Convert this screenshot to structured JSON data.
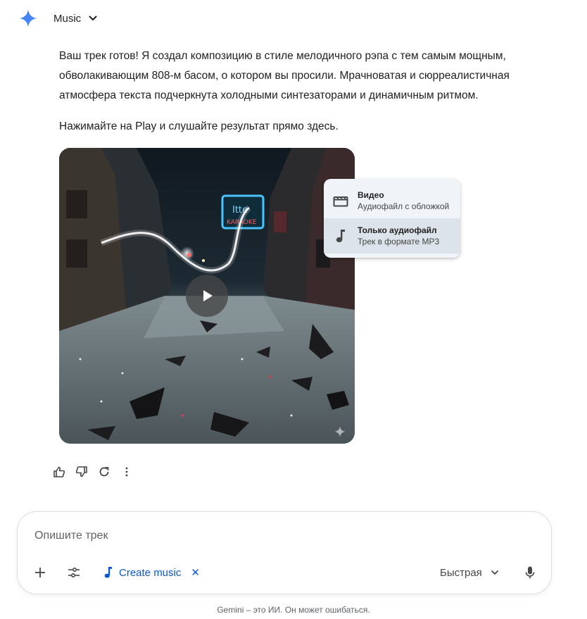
{
  "header": {
    "model_label": "Music",
    "logo_icon": "gemini-sparkle-icon",
    "logo_color": "#4285f4"
  },
  "response": {
    "paragraph_1": "Ваш трек готов! Я создал композицию в стиле мелодичного рэпа с тем самым мощным, обволакивающим 808-м басом, о котором вы просили. Мрачноватая и сюрреалистичная атмосфера текста подчеркнута холодными синтезаторами и динамичным ритмом.",
    "paragraph_2": "Нажимайте на Play и слушайте результат прямо здесь."
  },
  "download_menu": {
    "items": [
      {
        "icon": "movie-clapper-icon",
        "title": "Видео",
        "subtitle": "Аудиофайл с обложкой"
      },
      {
        "icon": "music-note-icon",
        "title": "Только аудиофайл",
        "subtitle": "Трек в формате MP3"
      }
    ]
  },
  "actions": {
    "icons": [
      "thumbs-up-icon",
      "thumbs-down-icon",
      "regenerate-icon",
      "more-vert-icon"
    ]
  },
  "composer": {
    "placeholder": "Опишите трек",
    "value": "",
    "chip_label": "Create music",
    "chip_close": "✕",
    "mode_label": "Быстрая"
  },
  "footer": {
    "disclaimer": "Gemini – это ИИ. Он может ошибаться."
  },
  "colors": {
    "accent": "#0b57d0",
    "menu_bg": "#f0f4f9",
    "menu_selected_bg": "#dde3ea"
  }
}
